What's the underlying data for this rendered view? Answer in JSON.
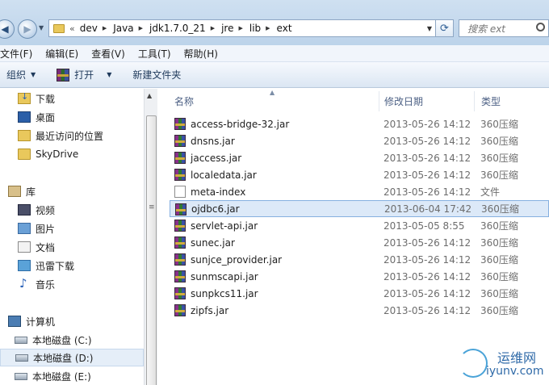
{
  "address": {
    "chevron": "«",
    "crumbs": [
      "dev",
      "Java",
      "jdk1.7.0_21",
      "jre",
      "lib",
      "ext"
    ],
    "search_placeholder": "搜索 ext"
  },
  "menu": [
    "文件(F)",
    "编辑(E)",
    "查看(V)",
    "工具(T)",
    "帮助(H)"
  ],
  "toolbar": {
    "organize": "组织",
    "open": "打开",
    "new_folder": "新建文件夹"
  },
  "nav": {
    "items": [
      {
        "label": "下载",
        "icon": "download-folder-icon"
      },
      {
        "label": "桌面",
        "icon": "desktop-icon"
      },
      {
        "label": "最近访问的位置",
        "icon": "recent-places-icon"
      },
      {
        "label": "SkyDrive",
        "icon": "folder-icon"
      },
      {
        "label": "库",
        "icon": "library-icon"
      },
      {
        "label": "视频",
        "icon": "video-icon"
      },
      {
        "label": "图片",
        "icon": "picture-icon"
      },
      {
        "label": "文档",
        "icon": "document-icon"
      },
      {
        "label": "迅雷下载",
        "icon": "xunlei-icon"
      },
      {
        "label": "音乐",
        "icon": "music-icon"
      },
      {
        "label": "计算机",
        "icon": "computer-icon"
      },
      {
        "label": "本地磁盘 (C:)",
        "icon": "drive-icon"
      },
      {
        "label": "本地磁盘 (D:)",
        "icon": "drive-icon"
      },
      {
        "label": "本地磁盘 (E:)",
        "icon": "drive-icon"
      }
    ]
  },
  "columns": {
    "name": "名称",
    "modified": "修改日期",
    "type": "类型"
  },
  "files": [
    {
      "name": "access-bridge-32.jar",
      "modified": "2013-05-26 14:12",
      "type": "360压缩",
      "icon": "jar"
    },
    {
      "name": "dnsns.jar",
      "modified": "2013-05-26 14:12",
      "type": "360压缩",
      "icon": "jar"
    },
    {
      "name": "jaccess.jar",
      "modified": "2013-05-26 14:12",
      "type": "360压缩",
      "icon": "jar"
    },
    {
      "name": "localedata.jar",
      "modified": "2013-05-26 14:12",
      "type": "360压缩",
      "icon": "jar"
    },
    {
      "name": "meta-index",
      "modified": "2013-05-26 14:12",
      "type": "文件",
      "icon": "plain"
    },
    {
      "name": "ojdbc6.jar",
      "modified": "2013-06-04 17:42",
      "type": "360压缩",
      "icon": "jar"
    },
    {
      "name": "servlet-api.jar",
      "modified": "2013-05-05 8:55",
      "type": "360压缩",
      "icon": "jar"
    },
    {
      "name": "sunec.jar",
      "modified": "2013-05-26 14:12",
      "type": "360压缩",
      "icon": "jar"
    },
    {
      "name": "sunjce_provider.jar",
      "modified": "2013-05-26 14:12",
      "type": "360压缩",
      "icon": "jar"
    },
    {
      "name": "sunmscapi.jar",
      "modified": "2013-05-26 14:12",
      "type": "360压缩",
      "icon": "jar"
    },
    {
      "name": "sunpkcs11.jar",
      "modified": "2013-05-26 14:12",
      "type": "360压缩",
      "icon": "jar"
    },
    {
      "name": "zipfs.jar",
      "modified": "2013-05-26 14:12",
      "type": "360压缩",
      "icon": "jar"
    }
  ],
  "watermark": {
    "cn": "运维网",
    "en": "iyunv.com"
  }
}
